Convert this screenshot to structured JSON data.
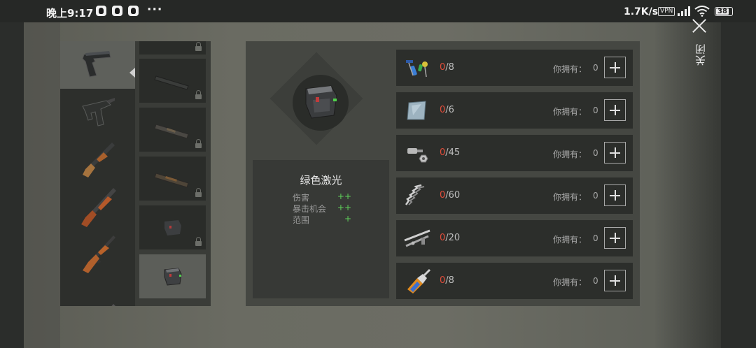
{
  "status_bar": {
    "time": "晚上9:17",
    "overflow": "···",
    "net_speed": "1.7K/s",
    "vpn": "VPN",
    "battery": "38",
    "icons": [
      "qq-icon",
      "qq-icon",
      "qq-icon",
      "signal-icon",
      "wifi-icon",
      "battery-icon"
    ]
  },
  "header": {
    "close_label": "关闭"
  },
  "weapons": [
    {
      "name": "pistol-icon",
      "selected": true
    },
    {
      "name": "uzi-icon",
      "selected": false
    },
    {
      "name": "shotgun-icon",
      "selected": false
    },
    {
      "name": "double-barrel-icon",
      "selected": false
    },
    {
      "name": "ak-rifle-icon",
      "selected": false
    },
    {
      "name": "rifle-partial-icon",
      "selected": false
    }
  ],
  "attachments": [
    {
      "name": "attachment-top-partial",
      "locked": true
    },
    {
      "name": "silencer-icon",
      "locked": true
    },
    {
      "name": "silencer-2-icon",
      "locked": true
    },
    {
      "name": "silencer-3-icon",
      "locked": true
    },
    {
      "name": "laser-icon",
      "locked": true
    },
    {
      "name": "green-laser-icon",
      "locked": false,
      "selected": true
    }
  ],
  "detail": {
    "item_name": "绿色激光",
    "stats": [
      {
        "label": "伤害",
        "value": "++"
      },
      {
        "label": "暴击机会",
        "value": "++"
      },
      {
        "label": "范围",
        "value": "+"
      }
    ],
    "stat_color": "#5fd15a"
  },
  "materials": [
    {
      "icon": "electronic-parts-icon",
      "have": "0",
      "need": "/8",
      "owned_label": "你拥有：",
      "owned": "0"
    },
    {
      "icon": "glass-plate-icon",
      "have": "0",
      "need": "/6",
      "owned_label": "你拥有：",
      "owned": "0"
    },
    {
      "icon": "bolt-nut-icon",
      "have": "0",
      "need": "/45",
      "owned_label": "你拥有：",
      "owned": "0"
    },
    {
      "icon": "spring-icon",
      "have": "0",
      "need": "/60",
      "owned_label": "你拥有：",
      "owned": "0"
    },
    {
      "icon": "metal-pipes-icon",
      "have": "0",
      "need": "/20",
      "owned_label": "你拥有：",
      "owned": "0"
    },
    {
      "icon": "glue-bottle-icon",
      "have": "0",
      "need": "/8",
      "owned_label": "你拥有：",
      "owned": "0"
    }
  ],
  "colors": {
    "insufficient": "#e34d3a",
    "panel": "#454742",
    "row": "#2c2e2b"
  }
}
